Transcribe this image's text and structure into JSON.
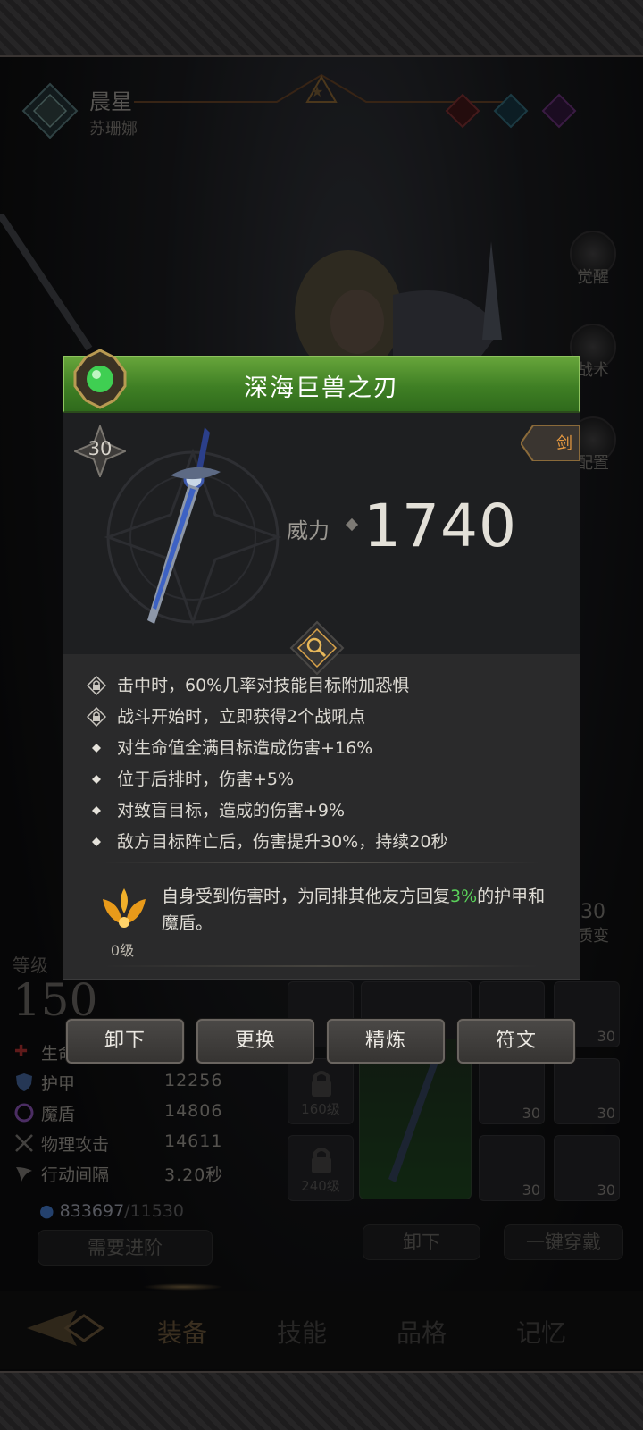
{
  "character": {
    "name": "晨星",
    "subtitle": "苏珊娜"
  },
  "side_buttons": [
    {
      "label": "觉醒",
      "icon": "sun-emblem-icon"
    },
    {
      "label": "战术",
      "icon": "banner-icon"
    },
    {
      "label": "配置",
      "icon": "helmet-icon"
    }
  ],
  "stats": {
    "level_label": "等级",
    "level": "150",
    "rows": [
      {
        "name": "生命",
        "value": "",
        "icon": "heart-icon"
      },
      {
        "name": "护甲",
        "value": "12256",
        "icon": "shield-icon"
      },
      {
        "name": "魔盾",
        "value": "14806",
        "icon": "swirl-icon"
      },
      {
        "name": "物理攻击",
        "value": "14611",
        "icon": "crossed-swords-icon"
      },
      {
        "name": "行动间隔",
        "value": "3.20秒",
        "icon": "wing-icon"
      }
    ],
    "gold": "833697",
    "gold_max": "/11530",
    "advance_button": "需要进阶"
  },
  "equipment": {
    "slot_level": "30",
    "locked_slots": [
      "160级",
      "240级"
    ],
    "unequip_all_button": "卸下",
    "equip_all_button": "一键穿戴"
  },
  "side_right": {
    "transform_label": "质变",
    "transform_level": "30"
  },
  "bottom_nav": [
    "装备",
    "技能",
    "品格",
    "记忆"
  ],
  "popup": {
    "title": "深海巨兽之刃",
    "item_level": "30",
    "weapon_type": "剑",
    "power_label": "威力",
    "power_value": "1740",
    "effects": [
      {
        "icon": "lock-icon",
        "text": "击中时，60%几率对技能目标附加恐惧"
      },
      {
        "icon": "lock-icon",
        "text": "战斗开始时，立即获得2个战吼点"
      },
      {
        "icon": "diamond-bullet-icon",
        "text": "对生命值全满目标造成伤害+16%"
      },
      {
        "icon": "diamond-bullet-icon",
        "text": "位于后排时，伤害+5%"
      },
      {
        "icon": "diamond-bullet-icon",
        "text": "对致盲目标，造成的伤害+9%"
      },
      {
        "icon": "diamond-bullet-icon",
        "text": "敌方目标阵亡后，伤害提升30%，持续20秒"
      }
    ],
    "passive": {
      "level": "0级",
      "text_before": "自身受到伤害时，为同排其他友方回复",
      "highlight": "3%",
      "text_after": "的护甲和魔盾。"
    },
    "accent_color": "#4e8f2d",
    "highlight_color": "#5ad15a"
  },
  "actions": [
    "卸下",
    "更换",
    "精炼",
    "符文"
  ]
}
